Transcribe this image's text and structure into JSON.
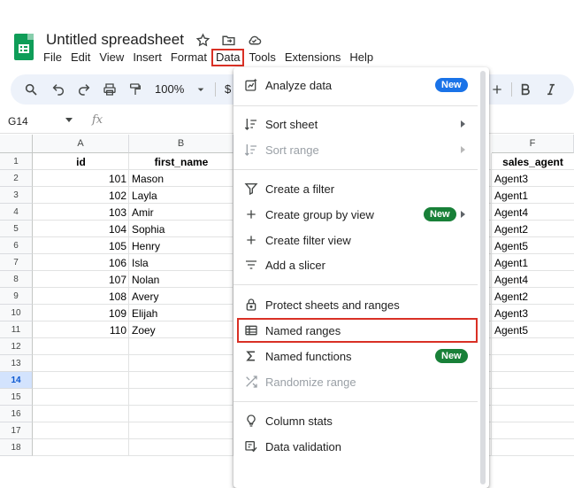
{
  "app": {
    "doc_title": "Untitled spreadsheet",
    "title_icons": [
      "star-icon",
      "move-to-folder-icon",
      "cloud-saved-icon"
    ]
  },
  "menubar": {
    "items": [
      "File",
      "Edit",
      "View",
      "Insert",
      "Format",
      "Data",
      "Tools",
      "Extensions",
      "Help"
    ],
    "active": "Data"
  },
  "toolbar": {
    "zoom": "100%",
    "currency": "$"
  },
  "namebox": {
    "cell": "G14",
    "fx": "fx"
  },
  "grid": {
    "columns": [
      "A",
      "B",
      "F"
    ],
    "rows": [
      "1",
      "2",
      "3",
      "4",
      "5",
      "6",
      "7",
      "8",
      "9",
      "10",
      "11",
      "12",
      "13",
      "14",
      "15",
      "16",
      "17",
      "18"
    ],
    "selected_row": "14",
    "header_row": [
      "id",
      "first_name",
      "sales_agent"
    ],
    "data": [
      [
        "101",
        "Mason",
        "Agent3"
      ],
      [
        "102",
        "Layla",
        "Agent1"
      ],
      [
        "103",
        "Amir",
        "Agent4"
      ],
      [
        "104",
        "Sophia",
        "Agent2"
      ],
      [
        "105",
        "Henry",
        "Agent5"
      ],
      [
        "106",
        "Isla",
        "Agent1"
      ],
      [
        "107",
        "Nolan",
        "Agent4"
      ],
      [
        "108",
        "Avery",
        "Agent2"
      ],
      [
        "109",
        "Elijah",
        "Agent3"
      ],
      [
        "110",
        "Zoey",
        "Agent5"
      ]
    ]
  },
  "data_menu": {
    "analyze": {
      "label": "Analyze data",
      "badge": "New"
    },
    "sort_sheet": "Sort sheet",
    "sort_range": "Sort range",
    "create_filter": "Create a filter",
    "create_group_by_view": {
      "label": "Create group by view",
      "badge": "New"
    },
    "create_filter_view": "Create filter view",
    "add_slicer": "Add a slicer",
    "protect": "Protect sheets and ranges",
    "named_ranges": "Named ranges",
    "named_functions": {
      "label": "Named functions",
      "badge": "New"
    },
    "randomize_range": "Randomize range",
    "column_stats": "Column stats",
    "data_validation": "Data validation"
  },
  "colors": {
    "highlight_box": "#d93025",
    "new_badge_blue": "#1a73e8",
    "new_badge_green": "#188038",
    "selected_row_header": "#d3e3fd"
  }
}
